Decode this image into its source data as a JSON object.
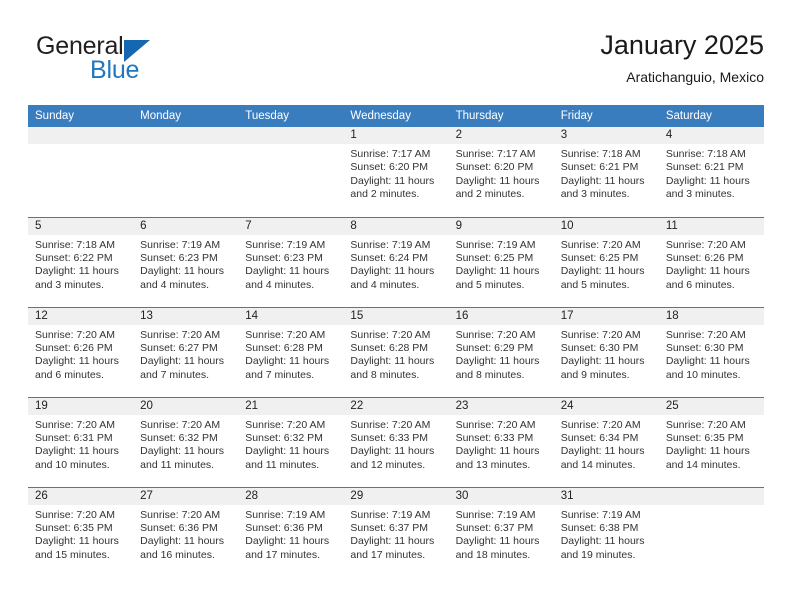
{
  "brand": {
    "name_part1": "General",
    "name_part2": "Blue",
    "logo_color": "#1667b1",
    "text_color": "#231f20",
    "accent_color": "#2176bd"
  },
  "header": {
    "title": "January 2025",
    "subtitle": "Aratichanguio, Mexico"
  },
  "theme": {
    "header_row_bg": "#3a7dbf",
    "daynum_bg": "#f0f0f0",
    "grid_line": "#3a7dbf"
  },
  "weekdays": [
    "Sunday",
    "Monday",
    "Tuesday",
    "Wednesday",
    "Thursday",
    "Friday",
    "Saturday"
  ],
  "weeks": [
    [
      {
        "day": "",
        "empty": true
      },
      {
        "day": "",
        "empty": true
      },
      {
        "day": "",
        "empty": true
      },
      {
        "day": "1",
        "sunrise": "Sunrise: 7:17 AM",
        "sunset": "Sunset: 6:20 PM",
        "daylight_1": "Daylight: 11 hours",
        "daylight_2": "and 2 minutes."
      },
      {
        "day": "2",
        "sunrise": "Sunrise: 7:17 AM",
        "sunset": "Sunset: 6:20 PM",
        "daylight_1": "Daylight: 11 hours",
        "daylight_2": "and 2 minutes."
      },
      {
        "day": "3",
        "sunrise": "Sunrise: 7:18 AM",
        "sunset": "Sunset: 6:21 PM",
        "daylight_1": "Daylight: 11 hours",
        "daylight_2": "and 3 minutes."
      },
      {
        "day": "4",
        "sunrise": "Sunrise: 7:18 AM",
        "sunset": "Sunset: 6:21 PM",
        "daylight_1": "Daylight: 11 hours",
        "daylight_2": "and 3 minutes."
      }
    ],
    [
      {
        "day": "5",
        "sunrise": "Sunrise: 7:18 AM",
        "sunset": "Sunset: 6:22 PM",
        "daylight_1": "Daylight: 11 hours",
        "daylight_2": "and 3 minutes."
      },
      {
        "day": "6",
        "sunrise": "Sunrise: 7:19 AM",
        "sunset": "Sunset: 6:23 PM",
        "daylight_1": "Daylight: 11 hours",
        "daylight_2": "and 4 minutes."
      },
      {
        "day": "7",
        "sunrise": "Sunrise: 7:19 AM",
        "sunset": "Sunset: 6:23 PM",
        "daylight_1": "Daylight: 11 hours",
        "daylight_2": "and 4 minutes."
      },
      {
        "day": "8",
        "sunrise": "Sunrise: 7:19 AM",
        "sunset": "Sunset: 6:24 PM",
        "daylight_1": "Daylight: 11 hours",
        "daylight_2": "and 4 minutes."
      },
      {
        "day": "9",
        "sunrise": "Sunrise: 7:19 AM",
        "sunset": "Sunset: 6:25 PM",
        "daylight_1": "Daylight: 11 hours",
        "daylight_2": "and 5 minutes."
      },
      {
        "day": "10",
        "sunrise": "Sunrise: 7:20 AM",
        "sunset": "Sunset: 6:25 PM",
        "daylight_1": "Daylight: 11 hours",
        "daylight_2": "and 5 minutes."
      },
      {
        "day": "11",
        "sunrise": "Sunrise: 7:20 AM",
        "sunset": "Sunset: 6:26 PM",
        "daylight_1": "Daylight: 11 hours",
        "daylight_2": "and 6 minutes."
      }
    ],
    [
      {
        "day": "12",
        "sunrise": "Sunrise: 7:20 AM",
        "sunset": "Sunset: 6:26 PM",
        "daylight_1": "Daylight: 11 hours",
        "daylight_2": "and 6 minutes."
      },
      {
        "day": "13",
        "sunrise": "Sunrise: 7:20 AM",
        "sunset": "Sunset: 6:27 PM",
        "daylight_1": "Daylight: 11 hours",
        "daylight_2": "and 7 minutes."
      },
      {
        "day": "14",
        "sunrise": "Sunrise: 7:20 AM",
        "sunset": "Sunset: 6:28 PM",
        "daylight_1": "Daylight: 11 hours",
        "daylight_2": "and 7 minutes."
      },
      {
        "day": "15",
        "sunrise": "Sunrise: 7:20 AM",
        "sunset": "Sunset: 6:28 PM",
        "daylight_1": "Daylight: 11 hours",
        "daylight_2": "and 8 minutes."
      },
      {
        "day": "16",
        "sunrise": "Sunrise: 7:20 AM",
        "sunset": "Sunset: 6:29 PM",
        "daylight_1": "Daylight: 11 hours",
        "daylight_2": "and 8 minutes."
      },
      {
        "day": "17",
        "sunrise": "Sunrise: 7:20 AM",
        "sunset": "Sunset: 6:30 PM",
        "daylight_1": "Daylight: 11 hours",
        "daylight_2": "and 9 minutes."
      },
      {
        "day": "18",
        "sunrise": "Sunrise: 7:20 AM",
        "sunset": "Sunset: 6:30 PM",
        "daylight_1": "Daylight: 11 hours",
        "daylight_2": "and 10 minutes."
      }
    ],
    [
      {
        "day": "19",
        "sunrise": "Sunrise: 7:20 AM",
        "sunset": "Sunset: 6:31 PM",
        "daylight_1": "Daylight: 11 hours",
        "daylight_2": "and 10 minutes."
      },
      {
        "day": "20",
        "sunrise": "Sunrise: 7:20 AM",
        "sunset": "Sunset: 6:32 PM",
        "daylight_1": "Daylight: 11 hours",
        "daylight_2": "and 11 minutes."
      },
      {
        "day": "21",
        "sunrise": "Sunrise: 7:20 AM",
        "sunset": "Sunset: 6:32 PM",
        "daylight_1": "Daylight: 11 hours",
        "daylight_2": "and 11 minutes."
      },
      {
        "day": "22",
        "sunrise": "Sunrise: 7:20 AM",
        "sunset": "Sunset: 6:33 PM",
        "daylight_1": "Daylight: 11 hours",
        "daylight_2": "and 12 minutes."
      },
      {
        "day": "23",
        "sunrise": "Sunrise: 7:20 AM",
        "sunset": "Sunset: 6:33 PM",
        "daylight_1": "Daylight: 11 hours",
        "daylight_2": "and 13 minutes."
      },
      {
        "day": "24",
        "sunrise": "Sunrise: 7:20 AM",
        "sunset": "Sunset: 6:34 PM",
        "daylight_1": "Daylight: 11 hours",
        "daylight_2": "and 14 minutes."
      },
      {
        "day": "25",
        "sunrise": "Sunrise: 7:20 AM",
        "sunset": "Sunset: 6:35 PM",
        "daylight_1": "Daylight: 11 hours",
        "daylight_2": "and 14 minutes."
      }
    ],
    [
      {
        "day": "26",
        "sunrise": "Sunrise: 7:20 AM",
        "sunset": "Sunset: 6:35 PM",
        "daylight_1": "Daylight: 11 hours",
        "daylight_2": "and 15 minutes."
      },
      {
        "day": "27",
        "sunrise": "Sunrise: 7:20 AM",
        "sunset": "Sunset: 6:36 PM",
        "daylight_1": "Daylight: 11 hours",
        "daylight_2": "and 16 minutes."
      },
      {
        "day": "28",
        "sunrise": "Sunrise: 7:19 AM",
        "sunset": "Sunset: 6:36 PM",
        "daylight_1": "Daylight: 11 hours",
        "daylight_2": "and 17 minutes."
      },
      {
        "day": "29",
        "sunrise": "Sunrise: 7:19 AM",
        "sunset": "Sunset: 6:37 PM",
        "daylight_1": "Daylight: 11 hours",
        "daylight_2": "and 17 minutes."
      },
      {
        "day": "30",
        "sunrise": "Sunrise: 7:19 AM",
        "sunset": "Sunset: 6:37 PM",
        "daylight_1": "Daylight: 11 hours",
        "daylight_2": "and 18 minutes."
      },
      {
        "day": "31",
        "sunrise": "Sunrise: 7:19 AM",
        "sunset": "Sunset: 6:38 PM",
        "daylight_1": "Daylight: 11 hours",
        "daylight_2": "and 19 minutes."
      },
      {
        "day": "",
        "empty": true
      }
    ]
  ]
}
